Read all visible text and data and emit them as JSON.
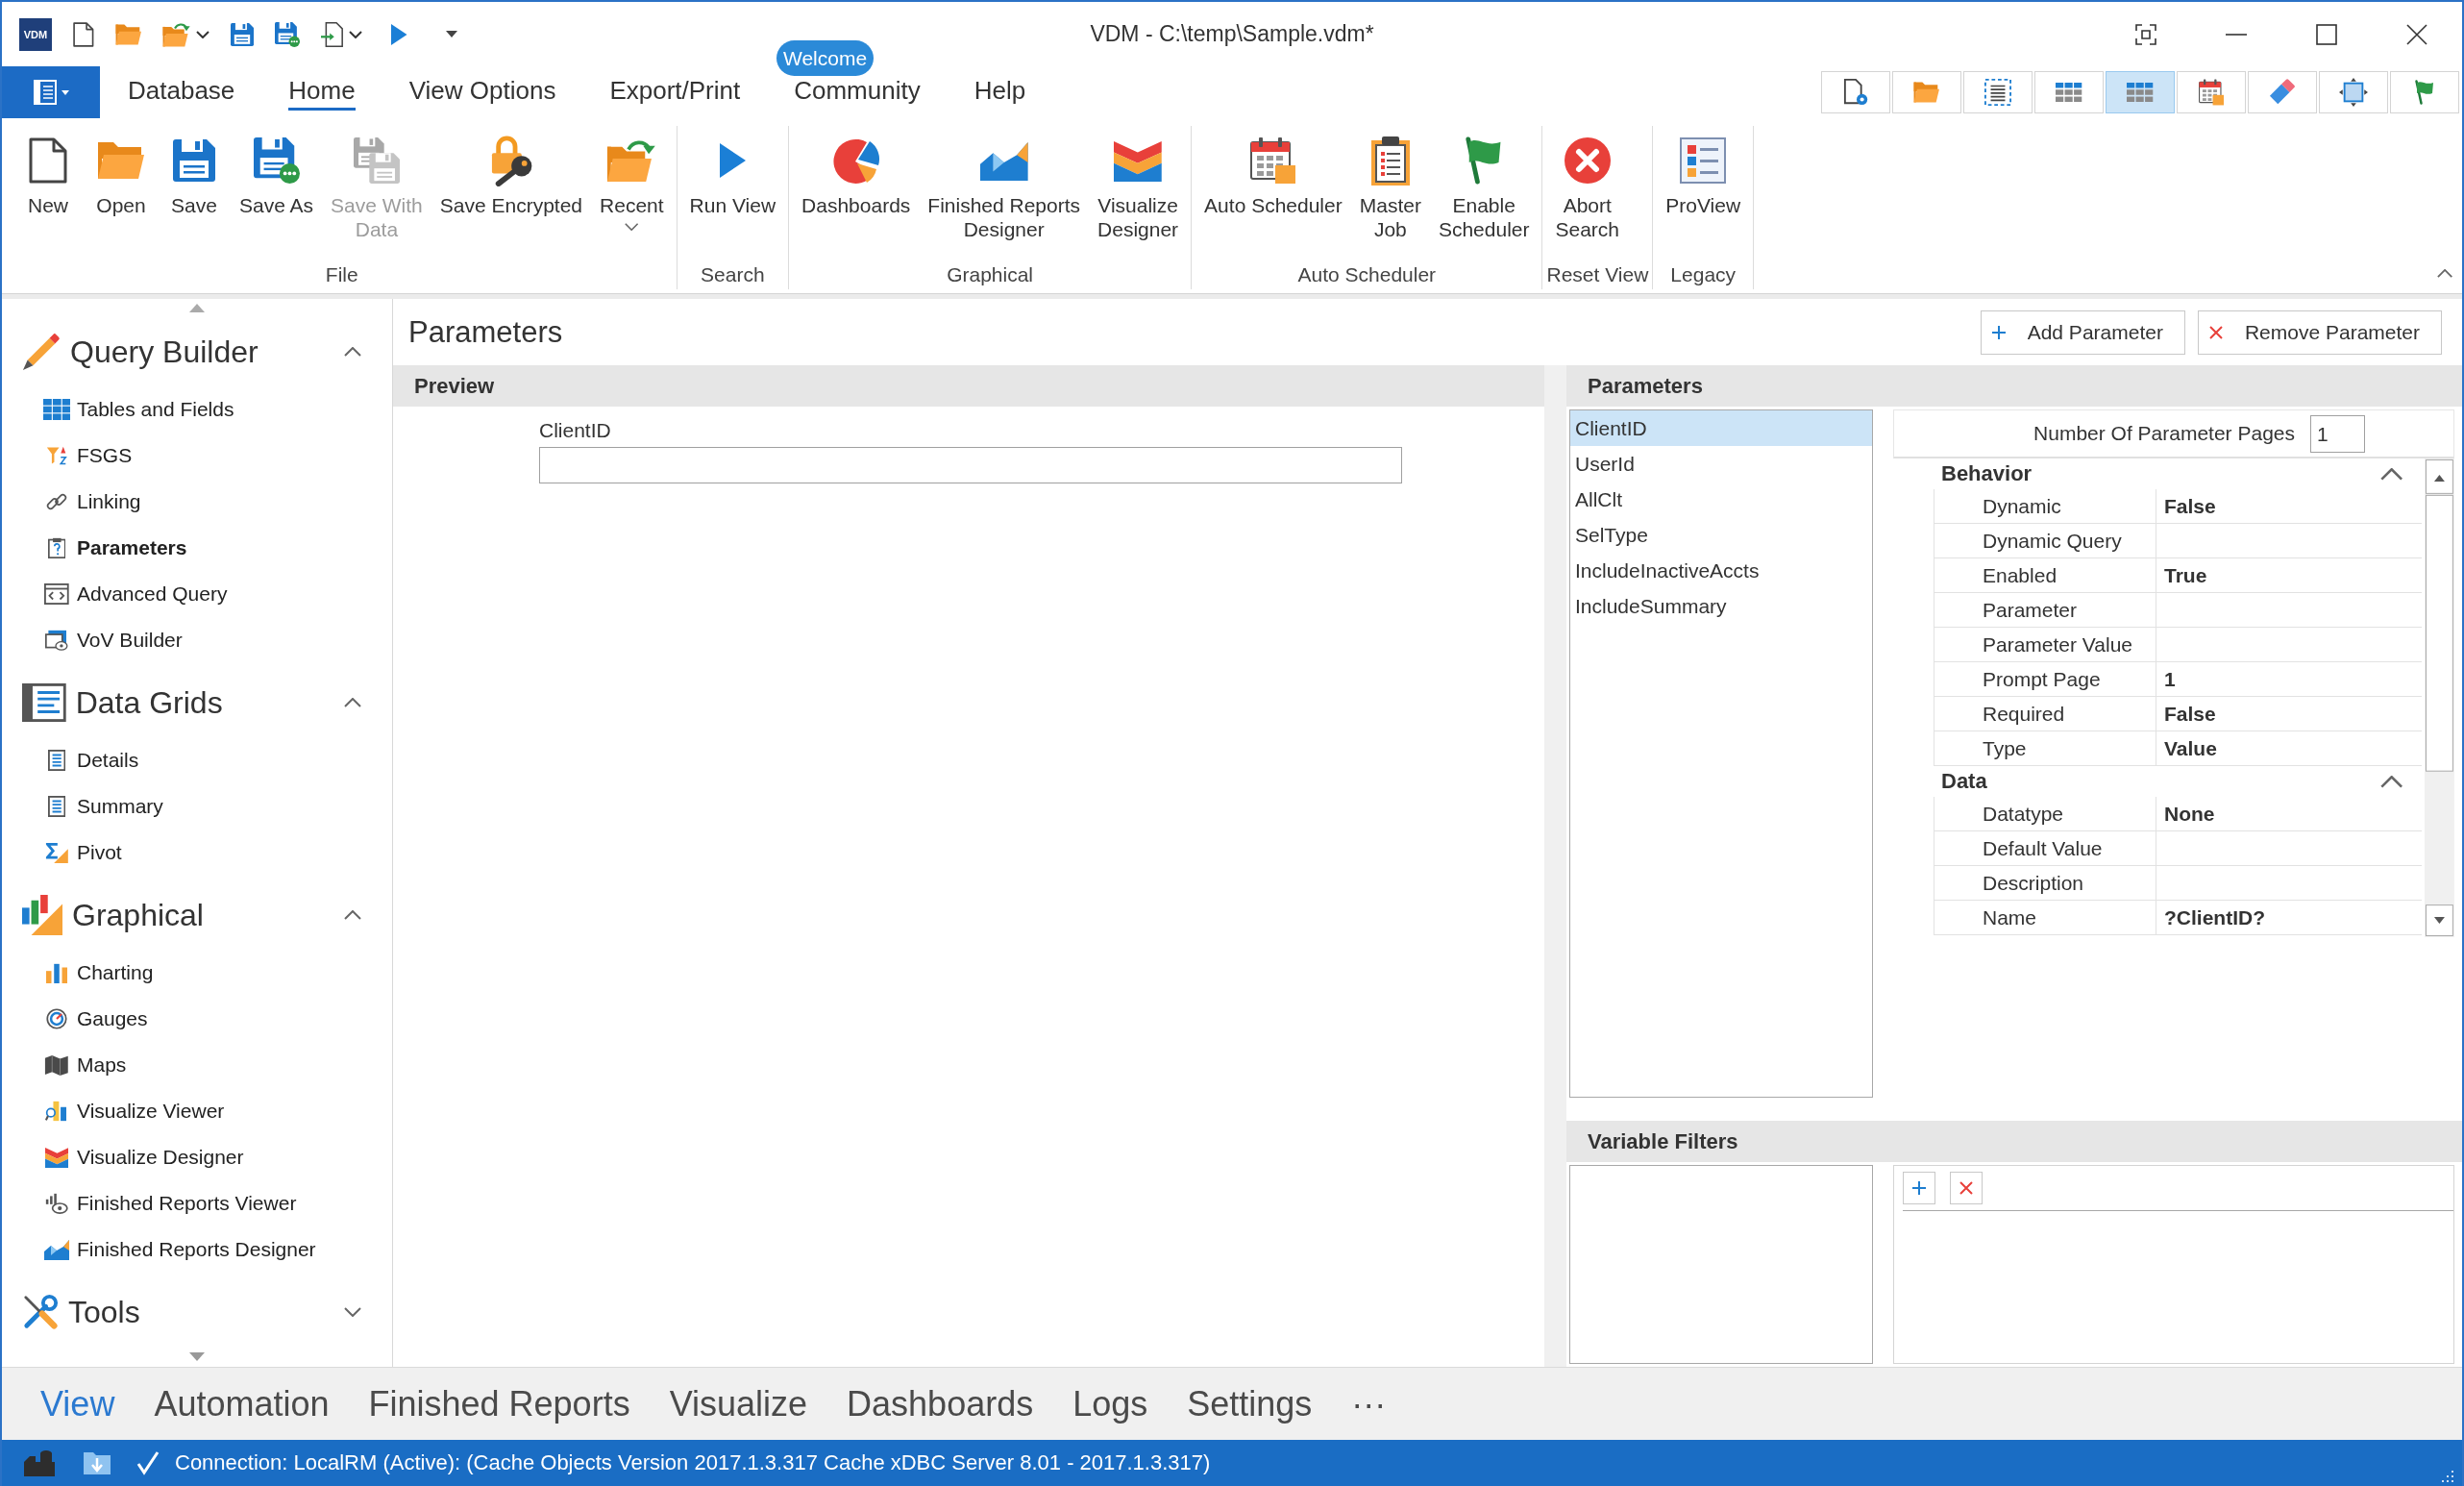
{
  "window": {
    "logo": "VDM",
    "title": "VDM - C:\\temp\\Sample.vdm*"
  },
  "welcome_badge": "Welcome",
  "ribbon": {
    "tabs": [
      {
        "label": "Database",
        "selected": false
      },
      {
        "label": "Home",
        "selected": true
      },
      {
        "label": "View Options",
        "selected": false
      },
      {
        "label": "Export/Print",
        "selected": false
      },
      {
        "label": "Community",
        "selected": false
      },
      {
        "label": "Help",
        "selected": false
      }
    ],
    "view_buttons": [
      {
        "selected": false
      },
      {
        "selected": false
      },
      {
        "selected": false
      },
      {
        "selected": false
      },
      {
        "selected": true
      },
      {
        "selected": false
      },
      {
        "selected": false
      },
      {
        "selected": false
      },
      {
        "selected": false
      }
    ],
    "groups": [
      {
        "label": "File",
        "buttons": [
          {
            "label": "New",
            "disabled": false,
            "dropdown": false
          },
          {
            "label": "Open",
            "disabled": false,
            "dropdown": false
          },
          {
            "label": "Save",
            "disabled": false,
            "dropdown": false
          },
          {
            "label": "Save As",
            "disabled": false,
            "dropdown": false
          },
          {
            "label": "Save With\nData",
            "disabled": true,
            "dropdown": false
          },
          {
            "label": "Save Encrypted",
            "disabled": false,
            "dropdown": false
          },
          {
            "label": "Recent",
            "disabled": false,
            "dropdown": true
          }
        ]
      },
      {
        "label": "Search",
        "buttons": [
          {
            "label": "Run View",
            "disabled": false,
            "dropdown": false
          }
        ]
      },
      {
        "label": "Graphical",
        "buttons": [
          {
            "label": "Dashboards",
            "disabled": false,
            "dropdown": false
          },
          {
            "label": "Finished Reports\nDesigner",
            "disabled": false,
            "dropdown": false
          },
          {
            "label": "Visualize\nDesigner",
            "disabled": false,
            "dropdown": false
          }
        ]
      },
      {
        "label": "Auto Scheduler",
        "buttons": [
          {
            "label": "Auto Scheduler",
            "disabled": false,
            "dropdown": false
          },
          {
            "label": "Master\nJob",
            "disabled": false,
            "dropdown": false
          },
          {
            "label": "Enable\nScheduler",
            "disabled": false,
            "dropdown": false
          }
        ]
      },
      {
        "label": "Reset View",
        "buttons": [
          {
            "label": "Abort\nSearch",
            "disabled": false,
            "dropdown": false
          }
        ]
      },
      {
        "label": "Legacy",
        "buttons": [
          {
            "label": "ProView",
            "disabled": false,
            "dropdown": false
          }
        ]
      }
    ]
  },
  "sidebar": {
    "sections": [
      {
        "title": "Query Builder",
        "expanded": true,
        "items": [
          {
            "label": "Tables and Fields",
            "selected": false
          },
          {
            "label": "FSGS",
            "selected": false
          },
          {
            "label": "Linking",
            "selected": false
          },
          {
            "label": "Parameters",
            "selected": true
          },
          {
            "label": "Advanced Query",
            "selected": false
          },
          {
            "label": "VoV Builder",
            "selected": false
          }
        ]
      },
      {
        "title": "Data Grids",
        "expanded": true,
        "items": [
          {
            "label": "Details",
            "selected": false
          },
          {
            "label": "Summary",
            "selected": false
          },
          {
            "label": "Pivot",
            "selected": false
          }
        ]
      },
      {
        "title": "Graphical",
        "expanded": true,
        "items": [
          {
            "label": "Charting",
            "selected": false
          },
          {
            "label": "Gauges",
            "selected": false
          },
          {
            "label": "Maps",
            "selected": false
          },
          {
            "label": "Visualize Viewer",
            "selected": false
          },
          {
            "label": "Visualize Designer",
            "selected": false
          },
          {
            "label": "Finished Reports Viewer",
            "selected": false
          },
          {
            "label": "Finished Reports Designer",
            "selected": false
          }
        ]
      },
      {
        "title": "Tools",
        "expanded": false
      }
    ]
  },
  "page": {
    "title": "Parameters",
    "actions": [
      {
        "label": "Add Parameter"
      },
      {
        "label": "Remove Parameter"
      }
    ]
  },
  "preview": {
    "title": "Preview",
    "fields": [
      {
        "label": "ClientID"
      }
    ]
  },
  "parameters": {
    "title": "Parameters",
    "items": [
      {
        "label": "ClientID",
        "selected": true
      },
      {
        "label": "UserId",
        "selected": false
      },
      {
        "label": "AllClt",
        "selected": false
      },
      {
        "label": "SelType",
        "selected": false
      },
      {
        "label": "IncludeInactiveAccts",
        "selected": false
      },
      {
        "label": "IncludeSummary",
        "selected": false
      }
    ],
    "page_count": {
      "label": "Number Of Parameter Pages",
      "value": "1"
    },
    "categories": [
      {
        "name": "Behavior",
        "expanded": true,
        "properties": [
          {
            "name": "Dynamic",
            "value": "False"
          },
          {
            "name": "Dynamic Query"
          },
          {
            "name": "Enabled",
            "value": "True"
          },
          {
            "name": "Parameter"
          },
          {
            "name": "Parameter Value"
          },
          {
            "name": "Prompt Page",
            "value": "1"
          },
          {
            "name": "Required",
            "value": "False"
          },
          {
            "name": "Type",
            "value": "Value"
          }
        ]
      },
      {
        "name": "Data",
        "expanded": true,
        "properties": [
          {
            "name": "Datatype",
            "value": "None"
          },
          {
            "name": "Default Value"
          },
          {
            "name": "Description"
          },
          {
            "name": "Name",
            "value": "?ClientID?"
          }
        ]
      }
    ]
  },
  "variable_filters": {
    "title": "Variable Filters"
  },
  "bottom_nav": [
    {
      "label": "View",
      "selected": true
    },
    {
      "label": "Automation",
      "selected": false
    },
    {
      "label": "Finished Reports",
      "selected": false
    },
    {
      "label": "Visualize",
      "selected": false
    },
    {
      "label": "Dashboards",
      "selected": false
    },
    {
      "label": "Logs",
      "selected": false
    },
    {
      "label": "Settings",
      "selected": false
    },
    {
      "label": "···",
      "selected": false
    }
  ],
  "status_bar": {
    "connection": "Connection: LocalRM (Active): (Cache Objects Version 2017.1.3.317 Cache xDBC Server 8.01 - 2017.1.3.317)"
  }
}
